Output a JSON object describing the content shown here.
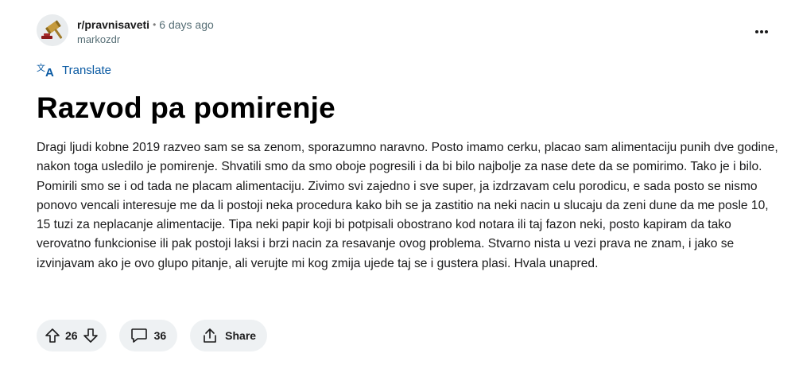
{
  "post": {
    "subreddit": "r/pravnisaveti",
    "separator": "•",
    "time_ago": "6 days ago",
    "author": "markozdr",
    "translate_label": "Translate",
    "title": "Razvod pa pomirenje",
    "body": "Dragi ljudi kobne 2019 razveo sam se sa zenom, sporazumno naravno. Posto imamo cerku, placao sam alimentaciju punih dve godine, nakon toga usledilo je pomirenje. Shvatili smo da smo oboje pogresili i da bi bilo najbolje za nase dete da se pomirimo. Tako je i bilo. Pomirili smo se i od tada ne placam alimentaciju. Zivimo svi zajedno i sve super, ja izdrzavam celu porodicu, e sada posto se nismo ponovo vencali interesuje me da li postoji neka procedura kako bih se ja zastitio na neki nacin u slucaju da zeni dune da me posle 10, 15 tuzi za neplacanje alimentacije. Tipa neki papir koji bi potpisali obostrano kod notara ili taj fazon neki, posto kapiram da tako verovatno funkcionise ili pak postoji laksi i brzi nacin za resavanje ovog problema. Stvarno nista u vezi prava ne znam, i jako se izvinjavam ako je ovo glupo pitanje, ali verujte mi kog zmija ujede taj se i gustera plasi. Hvala unapred."
  },
  "actions": {
    "vote_count": "26",
    "comment_count": "36",
    "share_label": "Share"
  },
  "icons": {
    "avatar": "gavel-avatar-icon",
    "more": "more-options-icon",
    "translate": "translate-icon",
    "upvote": "upvote-arrow-icon",
    "downvote": "downvote-arrow-icon",
    "comment": "comment-bubble-icon",
    "share": "share-icon"
  },
  "colors": {
    "link_blue": "#0a5aa3",
    "pill_bg": "#eef1f3",
    "text": "#1a1a1b",
    "meta_gray": "#576f76"
  }
}
